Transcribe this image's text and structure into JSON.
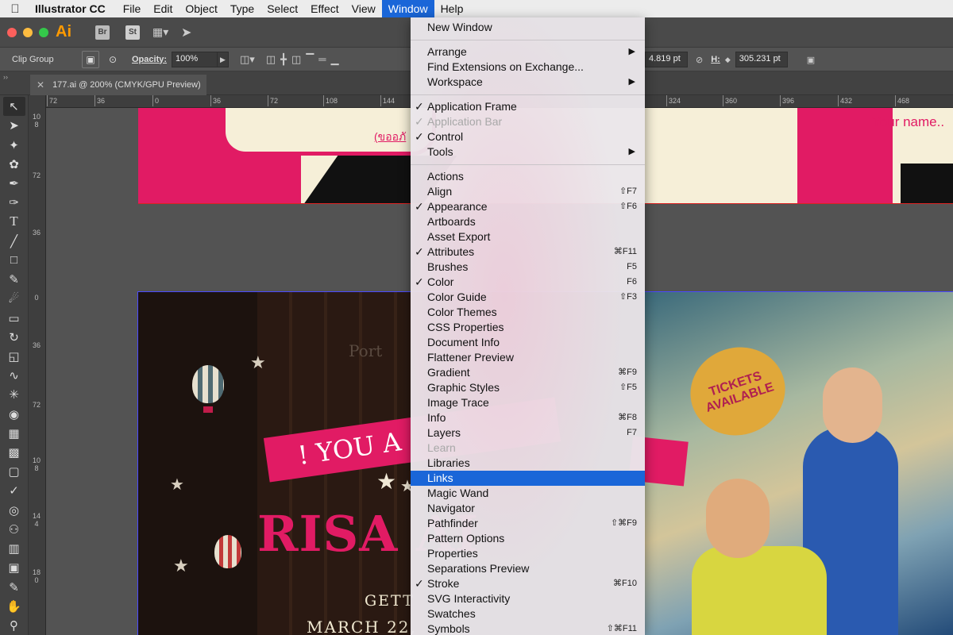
{
  "menubar": {
    "app_name": "Illustrator CC",
    "items": [
      "File",
      "Edit",
      "Object",
      "Type",
      "Select",
      "Effect",
      "View",
      "Window",
      "Help"
    ],
    "active": "Window"
  },
  "appbar": {
    "logo": "Ai",
    "bridge": "Br",
    "stock": "St"
  },
  "control": {
    "selection_label": "Clip Group",
    "opacity_label": "Opacity:",
    "opacity_value": "100%",
    "w_value": "4.819 pt",
    "h_label": "H:",
    "h_value": "305.231 pt"
  },
  "document_tab": {
    "title": "177.ai @ 200% (CMYK/GPU Preview)"
  },
  "rulers": {
    "h_ticks": [
      "72",
      "36",
      "0",
      "36",
      "72",
      "108",
      "144",
      "324",
      "360",
      "396",
      "432",
      "468"
    ],
    "v_ticks": [
      "108",
      "72",
      "36",
      "0",
      "36",
      "72",
      "108",
      "144",
      "180"
    ]
  },
  "artwork": {
    "thai_link": "(ขออภั",
    "your_name": "Your name..",
    "port": "Port",
    "ticket": "TICKETS AVAILABLE",
    "banner": "! YOU A",
    "title": "RISA AI",
    "getting": "GETT",
    "date": "MARCH 22,"
  },
  "window_menu": {
    "groups": [
      [
        {
          "label": "New Window"
        }
      ],
      [
        {
          "label": "Arrange",
          "submenu": true
        },
        {
          "label": "Find Extensions on Exchange..."
        },
        {
          "label": "Workspace",
          "submenu": true
        }
      ],
      [
        {
          "label": "Application Frame",
          "checked": true
        },
        {
          "label": "Application Bar",
          "checked": true,
          "disabled": true
        },
        {
          "label": "Control",
          "checked": true
        },
        {
          "label": "Tools",
          "submenu": true
        }
      ],
      [
        {
          "label": "Actions"
        },
        {
          "label": "Align",
          "shortcut": "⇧F7"
        },
        {
          "label": "Appearance",
          "checked": true,
          "shortcut": "⇧F6"
        },
        {
          "label": "Artboards"
        },
        {
          "label": "Asset Export"
        },
        {
          "label": "Attributes",
          "checked": true,
          "shortcut": "⌘F11"
        },
        {
          "label": "Brushes",
          "shortcut": "F5"
        },
        {
          "label": "Color",
          "checked": true,
          "shortcut": "F6"
        },
        {
          "label": "Color Guide",
          "shortcut": "⇧F3"
        },
        {
          "label": "Color Themes"
        },
        {
          "label": "CSS Properties"
        },
        {
          "label": "Document Info"
        },
        {
          "label": "Flattener Preview"
        },
        {
          "label": "Gradient",
          "shortcut": "⌘F9"
        },
        {
          "label": "Graphic Styles",
          "shortcut": "⇧F5"
        },
        {
          "label": "Image Trace"
        },
        {
          "label": "Info",
          "shortcut": "⌘F8"
        },
        {
          "label": "Layers",
          "shortcut": "F7"
        },
        {
          "label": "Learn",
          "disabled": true
        },
        {
          "label": "Libraries"
        },
        {
          "label": "Links",
          "highlighted": true
        },
        {
          "label": "Magic Wand"
        },
        {
          "label": "Navigator"
        },
        {
          "label": "Pathfinder",
          "shortcut": "⇧⌘F9"
        },
        {
          "label": "Pattern Options"
        },
        {
          "label": "Properties"
        },
        {
          "label": "Separations Preview"
        },
        {
          "label": "Stroke",
          "checked": true,
          "shortcut": "⌘F10"
        },
        {
          "label": "SVG Interactivity"
        },
        {
          "label": "Swatches"
        },
        {
          "label": "Symbols",
          "shortcut": "⇧⌘F11"
        }
      ]
    ]
  }
}
